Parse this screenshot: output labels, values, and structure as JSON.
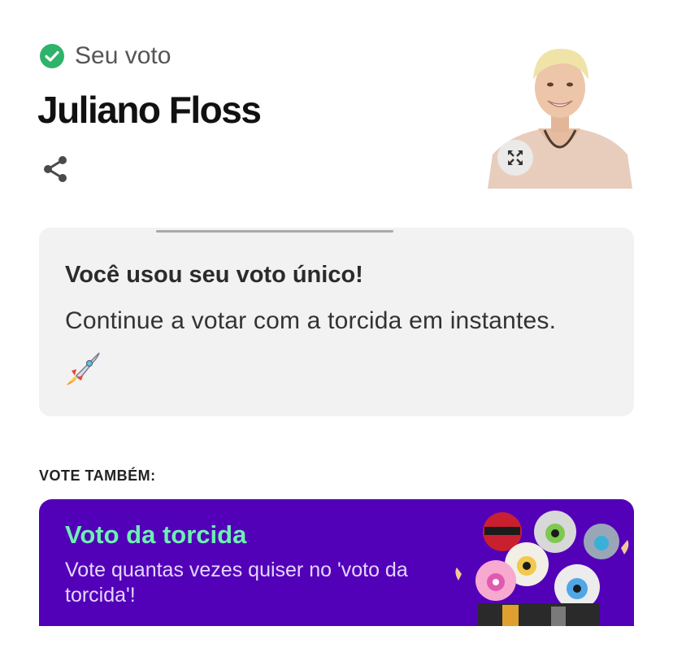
{
  "status": {
    "label": "Seu voto",
    "icon": "check-circle-icon",
    "color": "#2fb36b"
  },
  "candidate": {
    "name": "Juliano Floss"
  },
  "actions": {
    "share_icon": "share-icon",
    "expand_icon": "expand-icon"
  },
  "notice": {
    "title": "Você usou seu voto único!",
    "message": "Continue a votar com a torcida em instantes.",
    "emoji_icon": "rocket-icon"
  },
  "vote_also": {
    "heading": "VOTE TAMBÉM:",
    "promo": {
      "title": "Voto da torcida",
      "description": "Vote quantas vezes quiser no 'voto da torcida'!",
      "background_color": "#5300b9",
      "title_color": "#6ef0b2"
    }
  }
}
